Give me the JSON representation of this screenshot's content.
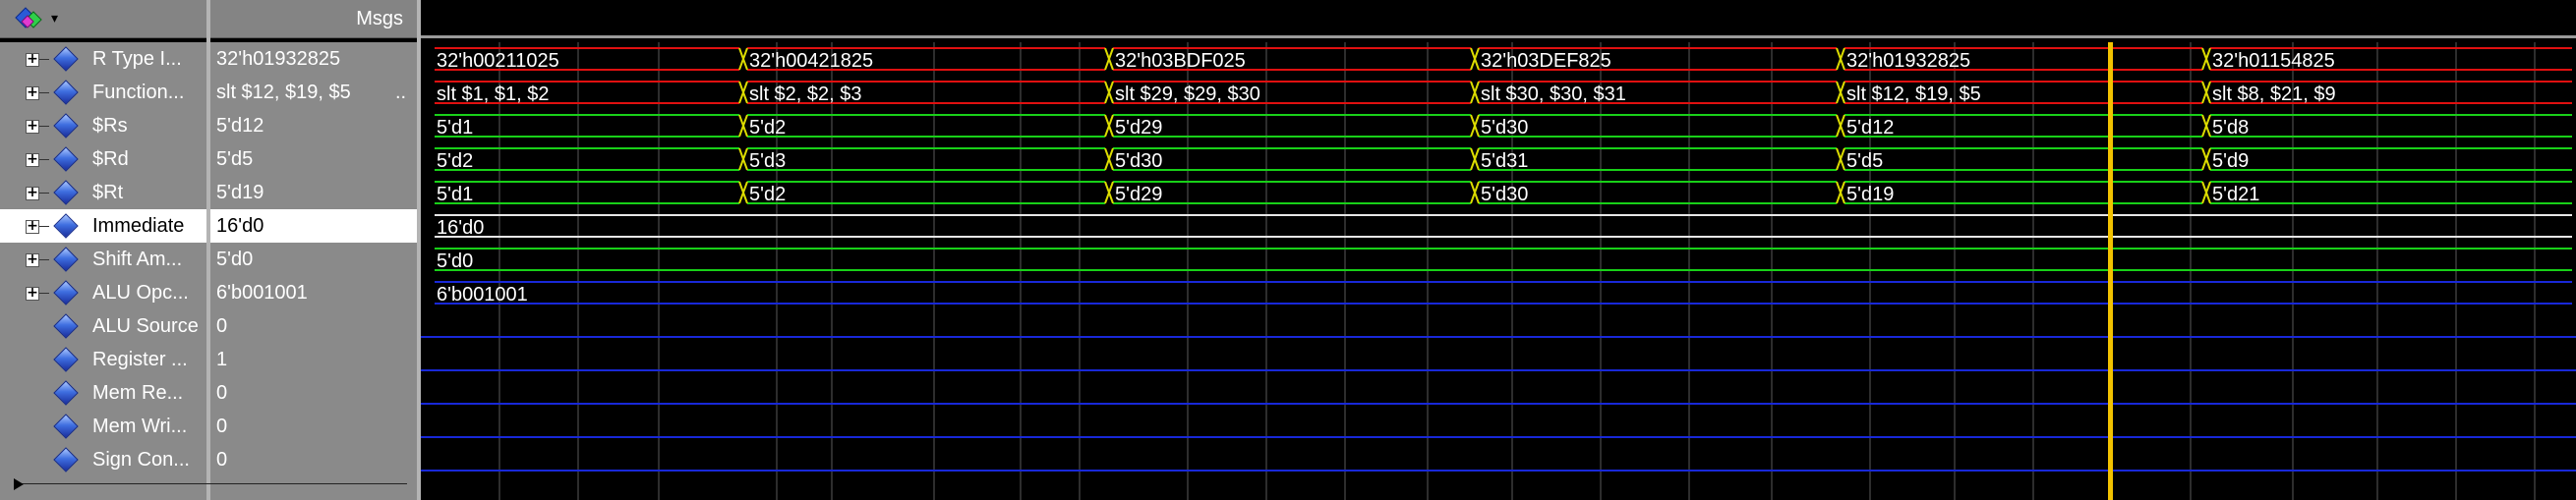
{
  "header": {
    "msgs_label": "Msgs",
    "logo_icon": "wave-diamond-logo-icon",
    "dropdown_icon": "dropdown-arrow-icon"
  },
  "signals": [
    {
      "name": "R Type I...",
      "value": "32'h01932825",
      "expandable": true,
      "radix_bus": true
    },
    {
      "name": "Function...",
      "value": "slt $12, $19, $5",
      "value_suffix": "..",
      "expandable": true,
      "radix_bus": true
    },
    {
      "name": "$Rs",
      "value": "5'd12",
      "expandable": true,
      "radix_bus": true
    },
    {
      "name": "$Rd",
      "value": "5'd5",
      "expandable": true,
      "radix_bus": true
    },
    {
      "name": "$Rt",
      "value": "5'd19",
      "expandable": true,
      "radix_bus": true
    },
    {
      "name": "Immediate",
      "value": "16'd0",
      "expandable": true,
      "radix_bus": true,
      "selected": true
    },
    {
      "name": "Shift Am...",
      "value": "5'd0",
      "expandable": true,
      "radix_bus": true
    },
    {
      "name": "ALU Opc...",
      "value": "6'b001001",
      "expandable": true,
      "radix_bus": true
    },
    {
      "name": "ALU Source",
      "value": "0",
      "expandable": false
    },
    {
      "name": "Register ...",
      "value": "1",
      "expandable": false
    },
    {
      "name": "Mem Re...",
      "value": "0",
      "expandable": false
    },
    {
      "name": "Mem Wri...",
      "value": "0",
      "expandable": false
    },
    {
      "name": "Sign Con...",
      "value": "0",
      "expandable": false
    }
  ],
  "waveform": {
    "colors": {
      "red": "#e01010",
      "green": "#18d018",
      "blue": "#1828d8",
      "white": "#e6e6e6",
      "grid": "#5a5a5a",
      "cursor": "#f2c200",
      "yellow_edge": "#dcdc00"
    },
    "cursor_label": "cursor",
    "rows": [
      {
        "color": "red",
        "segments": [
          "32'h00211025",
          "32'h00421825",
          "32'h03BDF025",
          "32'h03DEF825",
          "32'h01932825",
          "32'h01154825"
        ]
      },
      {
        "color": "red",
        "segments": [
          "slt $1, $1, $2",
          "slt $2, $2, $3",
          "slt $29, $29, $30",
          "slt $30, $30, $31",
          "slt $12, $19, $5",
          "slt $8, $21, $9"
        ]
      },
      {
        "color": "green",
        "segments": [
          "5'd1",
          "5'd2",
          "5'd29",
          "5'd30",
          "5'd12",
          "5'd8"
        ]
      },
      {
        "color": "green",
        "segments": [
          "5'd2",
          "5'd3",
          "5'd30",
          "5'd31",
          "5'd5",
          "5'd9"
        ]
      },
      {
        "color": "green",
        "segments": [
          "5'd1",
          "5'd2",
          "5'd29",
          "5'd30",
          "5'd19",
          "5'd21"
        ]
      },
      {
        "color": "white",
        "segments": [
          "16'd0"
        ]
      },
      {
        "color": "green",
        "segments": [
          "5'd0"
        ]
      },
      {
        "color": "blue",
        "segments": [
          "6'b001001"
        ]
      },
      {
        "color": "blue",
        "segments": []
      },
      {
        "color": "blue",
        "segments": []
      },
      {
        "color": "blue",
        "segments": []
      },
      {
        "color": "blue",
        "segments": []
      },
      {
        "color": "blue",
        "segments": []
      }
    ]
  }
}
